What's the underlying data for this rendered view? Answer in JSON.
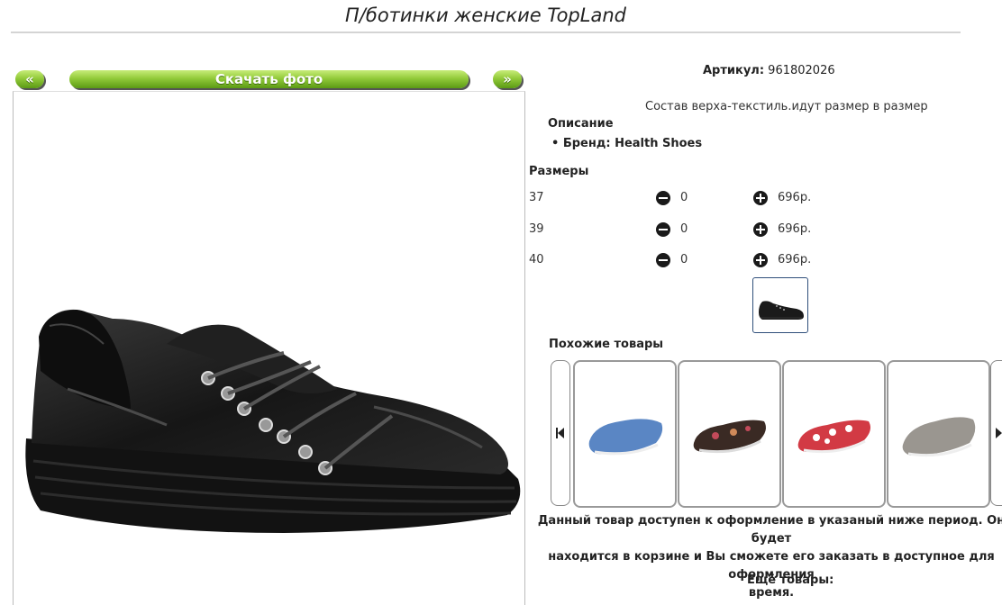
{
  "header": {
    "title": "П/ботинки женские TopLand"
  },
  "photo_nav": {
    "prev_label": "«",
    "download_label": "Скачать фото",
    "next_label": "»"
  },
  "product": {
    "article_label": "Артикул:",
    "article_value": "961802026",
    "composition": "Состав верха-текстиль.идут размер в размер",
    "description_heading": "Описание",
    "brand_line": "Бренд: Health Shoes",
    "sizes_heading": "Размеры",
    "sizes": [
      {
        "size": "37",
        "qty": "0",
        "price": "696р."
      },
      {
        "size": "39",
        "qty": "0",
        "price": "696р."
      },
      {
        "size": "40",
        "qty": "0",
        "price": "696р."
      }
    ]
  },
  "similar": {
    "heading": "Похожие товары",
    "items": [
      {
        "icon": "blue-slip-on-shoe-icon",
        "color": "#5a86c4"
      },
      {
        "icon": "floral-slip-on-shoe-icon",
        "color": "#3a2a24"
      },
      {
        "icon": "red-pattern-slip-on-shoe-icon",
        "color": "#d23a44"
      },
      {
        "icon": "grey-slip-on-shoe-icon",
        "color": "#9a9690"
      }
    ]
  },
  "notice": {
    "line1": "Данный товар доступен к оформление в указаный ниже период. Он будет",
    "line2": "находится в корзине и Вы сможете его заказать в доступное для оформления",
    "line3": "время."
  },
  "more": {
    "heading": "Ещё товары:"
  },
  "colors": {
    "accent_green": "#7bbf2a",
    "shoe_black": "#1a1a1a"
  }
}
